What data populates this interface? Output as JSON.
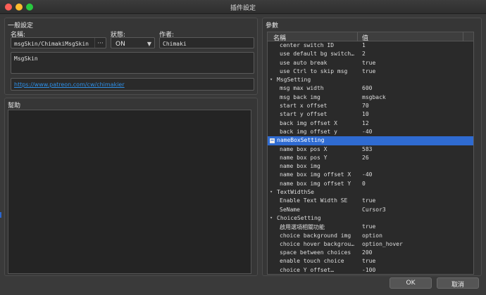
{
  "window": {
    "title": "插件設定"
  },
  "general": {
    "title": "一般設定",
    "name_label": "名稱:",
    "name_value": "msgSkin/ChimakiMsgSkin",
    "name_button": "···",
    "status_label": "狀態:",
    "status_value": "ON",
    "author_label": "作者:",
    "author_value": "Chimaki",
    "description": "MsgSkin",
    "url": "https://www.patreon.com/cw/chimakier"
  },
  "help": {
    "title": "幫助"
  },
  "params": {
    "title": "參數",
    "col_name": "名稱",
    "col_value": "值",
    "rows": [
      {
        "name": "center switch ID",
        "value": "1",
        "type": "item"
      },
      {
        "name": "use default bg switch id",
        "value": "2",
        "type": "item"
      },
      {
        "name": "use auto break",
        "value": "true",
        "type": "item"
      },
      {
        "name": "use Ctrl to skip msg",
        "value": "true",
        "type": "item"
      },
      {
        "name": "MsgSetting",
        "value": "",
        "type": "group",
        "twisty": "▾"
      },
      {
        "name": "msg max width",
        "value": "600",
        "type": "item"
      },
      {
        "name": "msg back img",
        "value": "msgback",
        "type": "item"
      },
      {
        "name": "start x offset",
        "value": "70",
        "type": "item"
      },
      {
        "name": "start y offset",
        "value": "10",
        "type": "item"
      },
      {
        "name": "back img offset X",
        "value": "12",
        "type": "item"
      },
      {
        "name": "back img offset y",
        "value": "-40",
        "type": "item"
      },
      {
        "name": "nameBoxSetting",
        "value": "",
        "type": "group",
        "twisty": "−",
        "selected": true
      },
      {
        "name": "name box pos X",
        "value": "583",
        "type": "item"
      },
      {
        "name": "name box pos Y",
        "value": "26",
        "type": "item"
      },
      {
        "name": "name box img",
        "value": "",
        "type": "item"
      },
      {
        "name": "name box img offset X",
        "value": "-40",
        "type": "item"
      },
      {
        "name": "name box img offset Y",
        "value": "0",
        "type": "item"
      },
      {
        "name": "TextWidthSe",
        "value": "",
        "type": "group",
        "twisty": "▾"
      },
      {
        "name": "Enable Text Width SE",
        "value": "true",
        "type": "item"
      },
      {
        "name": "SeName",
        "value": "Cursor3",
        "type": "item"
      },
      {
        "name": "ChoiceSetting",
        "value": "",
        "type": "group",
        "twisty": "▾"
      },
      {
        "name": "啟用選項相關功能",
        "value": "true",
        "type": "item"
      },
      {
        "name": "choice background img",
        "value": "option",
        "type": "item"
      },
      {
        "name": "choice hover background…",
        "value": "option_hover",
        "type": "item"
      },
      {
        "name": "space between choices",
        "value": "200",
        "type": "item"
      },
      {
        "name": "enable touch choice",
        "value": "true",
        "type": "item"
      },
      {
        "name": "choice Y offset…",
        "value": "-100",
        "type": "item"
      }
    ]
  },
  "buttons": {
    "ok": "OK",
    "cancel": "取消"
  },
  "colors": {
    "selection": "#2f6bd1",
    "link": "#2e8fe6"
  }
}
